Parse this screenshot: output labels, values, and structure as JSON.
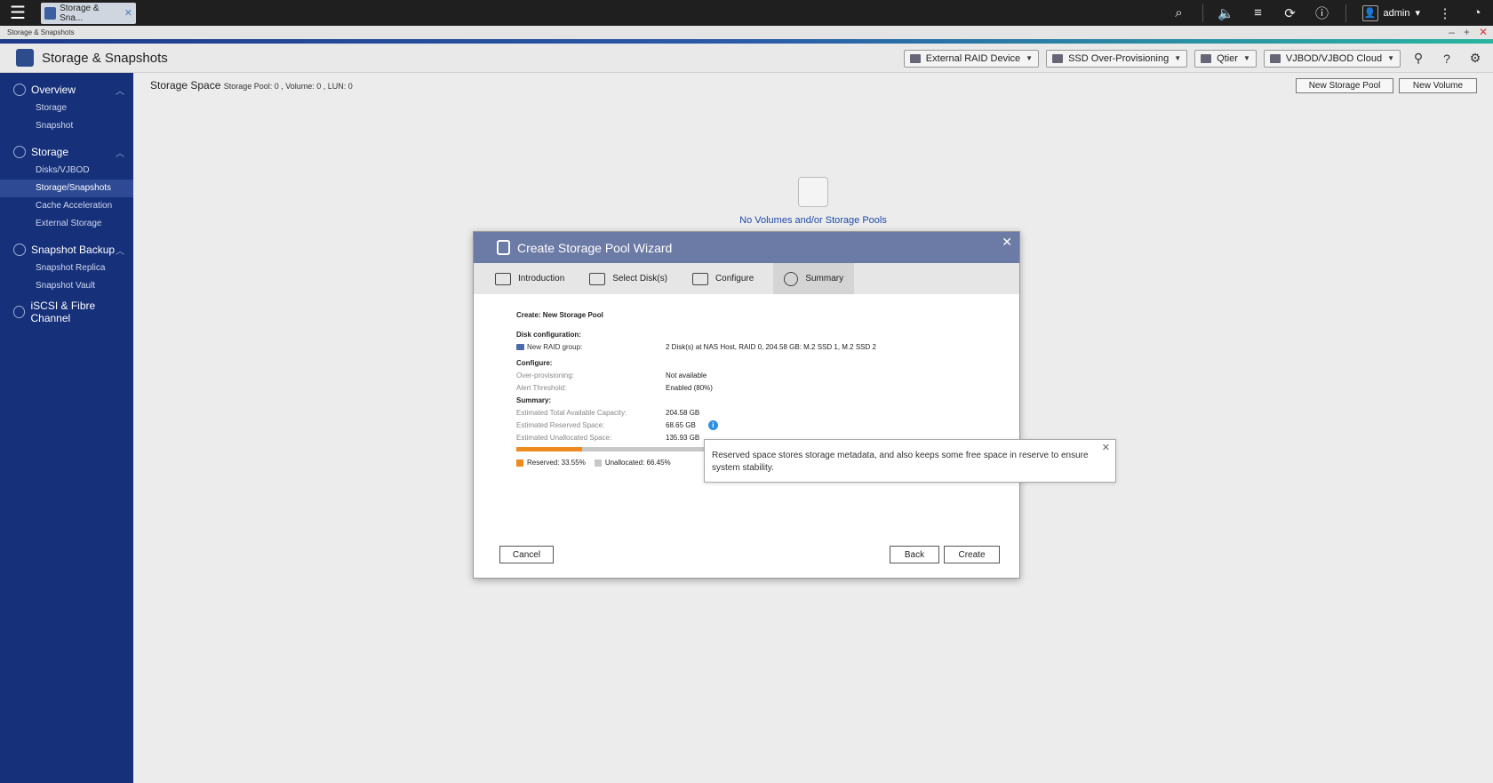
{
  "topbar": {
    "app_tab_label": "Storage & Sna...",
    "user": "admin"
  },
  "window": {
    "title": "Storage & Snapshots"
  },
  "header": {
    "title": "Storage & Snapshots",
    "dropdowns": [
      "External RAID Device",
      "SSD Over-Provisioning",
      "Qtier",
      "VJBOD/VJBOD Cloud"
    ]
  },
  "sidebar": {
    "overview": "Overview",
    "overview_items": [
      "Storage",
      "Snapshot"
    ],
    "storage": "Storage",
    "storage_items": [
      "Disks/VJBOD",
      "Storage/Snapshots",
      "Cache Acceleration",
      "External Storage"
    ],
    "snapshot_backup": "Snapshot Backup",
    "snapshot_items": [
      "Snapshot Replica",
      "Snapshot Vault"
    ],
    "iscsi": "iSCSI & Fibre Channel"
  },
  "main": {
    "title": "Storage Space",
    "subtitle": "Storage Pool: 0 , Volume: 0 , LUN: 0",
    "new_pool_btn": "New Storage Pool",
    "new_volume_btn": "New Volume",
    "empty_text": "No Volumes and/or Storage Pools"
  },
  "wizard": {
    "title": "Create Storage Pool Wizard",
    "steps": [
      "Introduction",
      "Select Disk(s)",
      "Configure",
      "Summary"
    ],
    "create_title": "Create: New Storage Pool",
    "disk_config_label": "Disk configuration:",
    "raid_group_label": "New RAID group:",
    "raid_group_value": "2 Disk(s) at NAS Host, RAID 0, 204.58 GB: M.2 SSD 1, M.2 SSD 2",
    "configure_label": "Configure:",
    "over_prov_label": "Over-provisioning:",
    "over_prov_value": "Not available",
    "alert_label": "Alert Threshold:",
    "alert_value": "Enabled (80%)",
    "summary_label": "Summary:",
    "total_label": "Estimated Total Available Capacity:",
    "total_value": "204.58 GB",
    "reserved_label": "Estimated Reserved Space:",
    "reserved_value": "68.65 GB",
    "unalloc_label": "Estimated Unallocated Space:",
    "unalloc_value": "135.93 GB",
    "reserved_fraction": 0.3355,
    "legend_reserved": "Reserved: 33.55%",
    "legend_unalloc": "Unallocated: 66.45%",
    "reserved_color": "#ef8a1e",
    "unalloc_color": "#c7c7c7",
    "cancel": "Cancel",
    "back": "Back",
    "create": "Create"
  },
  "tooltip": {
    "text": "Reserved space stores storage metadata, and also keeps some free space in reserve to ensure system stability."
  }
}
